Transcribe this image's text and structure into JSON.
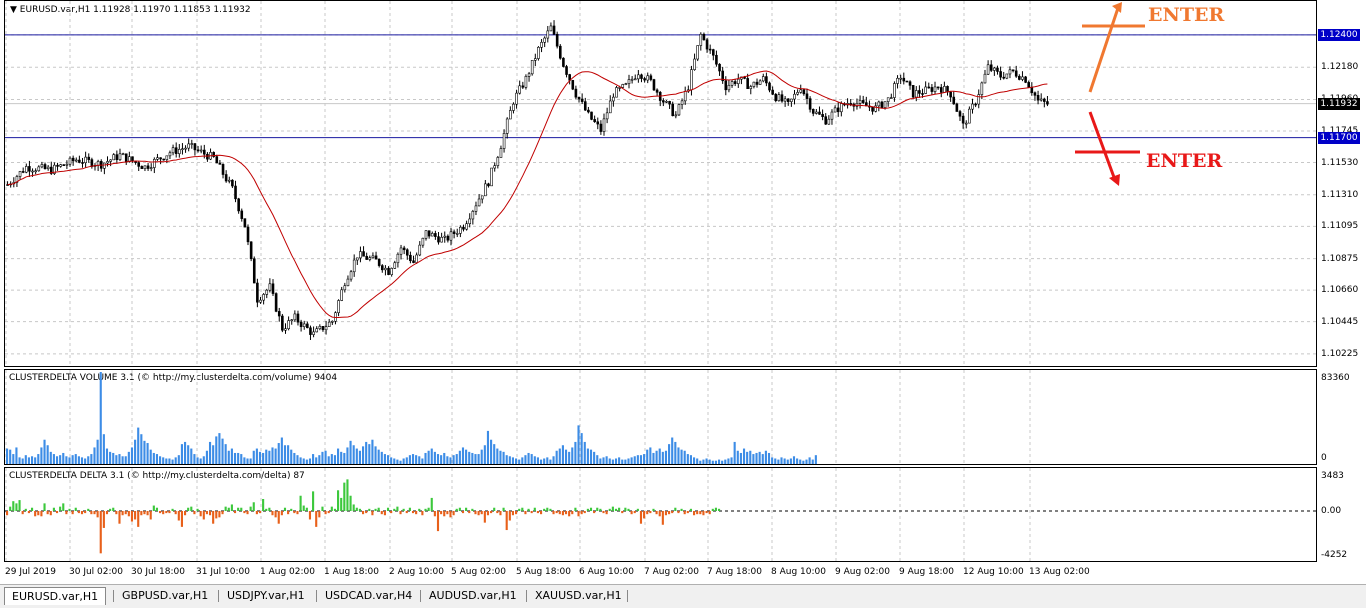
{
  "chart_window": {
    "symbol_title": "EURUSD.var,H1  1.11928 1.11970 1.11853 1.11932",
    "menu_icon": "triangle-down-icon"
  },
  "chart_data": [
    {
      "type": "candlestick",
      "title": "EURUSD.var,H1  1.11928 1.11970 1.11853 1.11932",
      "ylim": [
        1.1017,
        1.1257
      ],
      "y_ticks": [
        "1.12400",
        "1.12180",
        "1.11960",
        "1.11745",
        "1.11530",
        "1.11310",
        "1.11095",
        "1.10875",
        "1.10660",
        "1.10445",
        "1.10225"
      ],
      "x_ticks": [
        "29 Jul 2019",
        "30 Jul 02:00",
        "30 Jul 18:00",
        "31 Jul 10:00",
        "1 Aug 02:00",
        "1 Aug 18:00",
        "2 Aug 10:00",
        "5 Aug 02:00",
        "5 Aug 18:00",
        "6 Aug 10:00",
        "7 Aug 02:00",
        "7 Aug 18:00",
        "8 Aug 10:00",
        "9 Aug 02:00",
        "9 Aug 18:00",
        "12 Aug 10:00",
        "13 Aug 02:00"
      ],
      "current_price": "1.11932",
      "horizontal_levels": [
        "1.12400",
        "1.11700"
      ],
      "moving_average_color": "#c00000",
      "candle_color": "#000000",
      "grid": true,
      "close_path": [
        [
          0,
          1.1138
        ],
        [
          6,
          1.115
        ],
        [
          14,
          1.1148
        ],
        [
          22,
          1.1155
        ],
        [
          30,
          1.1152
        ],
        [
          36,
          1.1158
        ],
        [
          44,
          1.115
        ],
        [
          52,
          1.116
        ],
        [
          58,
          1.1164
        ],
        [
          66,
          1.1156
        ],
        [
          72,
          1.1135
        ],
        [
          76,
          1.111
        ],
        [
          80,
          1.106
        ],
        [
          84,
          1.1068
        ],
        [
          88,
          1.104
        ],
        [
          92,
          1.1047
        ],
        [
          98,
          1.1036
        ],
        [
          104,
          1.1045
        ],
        [
          108,
          1.1072
        ],
        [
          112,
          1.109
        ],
        [
          118,
          1.1086
        ],
        [
          122,
          1.1079
        ],
        [
          126,
          1.1095
        ],
        [
          130,
          1.1085
        ],
        [
          134,
          1.1105
        ],
        [
          140,
          1.11
        ],
        [
          146,
          1.111
        ],
        [
          150,
          1.1125
        ],
        [
          154,
          1.114
        ],
        [
          158,
          1.1165
        ],
        [
          162,
          1.1195
        ],
        [
          166,
          1.121
        ],
        [
          170,
          1.123
        ],
        [
          174,
          1.1245
        ],
        [
          178,
          1.122
        ],
        [
          182,
          1.12
        ],
        [
          186,
          1.1185
        ],
        [
          190,
          1.1175
        ],
        [
          194,
          1.12
        ],
        [
          198,
          1.1205
        ],
        [
          202,
          1.1215
        ],
        [
          206,
          1.1208
        ],
        [
          210,
          1.1195
        ],
        [
          214,
          1.1185
        ],
        [
          218,
          1.1205
        ],
        [
          222,
          1.124
        ],
        [
          226,
          1.1225
        ],
        [
          230,
          1.1205
        ],
        [
          234,
          1.121
        ],
        [
          238,
          1.1205
        ],
        [
          242,
          1.121
        ],
        [
          246,
          1.1198
        ],
        [
          250,
          1.1192
        ],
        [
          254,
          1.1205
        ],
        [
          258,
          1.1188
        ],
        [
          262,
          1.1182
        ],
        [
          266,
          1.119
        ],
        [
          270,
          1.1195
        ],
        [
          274,
          1.1192
        ],
        [
          278,
          1.119
        ],
        [
          282,
          1.1196
        ],
        [
          286,
          1.1212
        ],
        [
          290,
          1.12
        ],
        [
          294,
          1.1202
        ],
        [
          298,
          1.1205
        ],
        [
          302,
          1.12
        ],
        [
          306,
          1.1178
        ],
        [
          310,
          1.1195
        ],
        [
          314,
          1.1218
        ],
        [
          318,
          1.1212
        ],
        [
          322,
          1.1215
        ],
        [
          326,
          1.121
        ],
        [
          330,
          1.1195
        ],
        [
          333,
          1.1193
        ]
      ],
      "annotations": [
        {
          "text": "ENTER",
          "direction": "up",
          "color": "#f07830"
        },
        {
          "text": "ENTER",
          "direction": "down",
          "color": "#e81818"
        }
      ]
    },
    {
      "type": "bar",
      "title": "CLUSTERDELTA VOLUME 3.1 (© http://my.clusterdelta.com/volume) 9404",
      "ylim": [
        0,
        83360
      ],
      "y_ticks": [
        "83360",
        "0"
      ],
      "bar_color": "#3c8ce6",
      "values": [
        14000,
        13000,
        9000,
        15000,
        6000,
        5000,
        8000,
        6000,
        7000,
        6000,
        9000,
        15000,
        22000,
        17000,
        11000,
        9000,
        7000,
        8000,
        10000,
        7000,
        6000,
        8000,
        9000,
        7000,
        6000,
        5000,
        7000,
        9000,
        15000,
        22000,
        83360,
        27000,
        14000,
        11000,
        10000,
        8000,
        9000,
        7000,
        7000,
        11000,
        15000,
        22000,
        33000,
        27000,
        21000,
        19000,
        13000,
        10000,
        9000,
        7000,
        6000,
        5000,
        5000,
        4000,
        6000,
        8000,
        18000,
        20000,
        17000,
        14000,
        9000,
        6000,
        5000,
        7000,
        12000,
        20000,
        17000,
        25000,
        28000,
        23000,
        18000,
        12000,
        14000,
        10000,
        10000,
        9000,
        6000,
        5000,
        5000,
        12000,
        14000,
        11000,
        10000,
        13000,
        12000,
        15000,
        14000,
        19000,
        24000,
        17000,
        17000,
        13000,
        10000,
        8000,
        6000,
        5000,
        4000,
        5000,
        9000,
        6000,
        8000,
        11000,
        12000,
        7000,
        9000,
        8000,
        14000,
        11000,
        10000,
        15000,
        21000,
        17000,
        14000,
        12000,
        16000,
        20000,
        18000,
        22000,
        16000,
        13000,
        11000,
        9000,
        8000,
        6000,
        5000,
        4000,
        3000,
        5000,
        6000,
        8000,
        9000,
        8000,
        7000,
        5000,
        10000,
        12000,
        14000,
        11000,
        9000,
        8000,
        10000,
        7000,
        6000,
        8000,
        9000,
        12000,
        15000,
        13000,
        11000,
        10000,
        9000,
        9000,
        13000,
        17000,
        30000,
        22000,
        18000,
        14000,
        12000,
        11000,
        8000,
        7000,
        6000,
        5000,
        4000,
        6000,
        8000,
        10000,
        9000,
        7000,
        6000,
        4000,
        5000,
        6000,
        4000,
        7000,
        12000,
        14000,
        17000,
        13000,
        11000,
        15000,
        20000,
        35000,
        28000,
        20000,
        14000,
        13000,
        11000,
        8000,
        5000,
        6000,
        7000,
        5000,
        4000,
        5000,
        6000,
        4000,
        4000,
        5000,
        6000,
        7000,
        8000,
        8000,
        9000,
        13000,
        15000,
        10000,
        12000,
        14000,
        11000,
        12000,
        18000,
        24000,
        20000,
        15000,
        13000,
        12000,
        9000,
        8000,
        6000,
        5000,
        3000,
        4000,
        5000,
        4000,
        3000,
        3000,
        4000,
        3000,
        4000,
        5000,
        6000,
        20000,
        12000,
        10000,
        14000,
        11000,
        12000,
        9000,
        10000,
        11000,
        9000,
        12000,
        10000,
        6000,
        5000,
        4000,
        6000,
        5000,
        4000,
        5000,
        7000,
        5000,
        4000,
        3000,
        4000,
        6000,
        4000,
        8000
      ]
    },
    {
      "type": "bar",
      "title": "CLUSTERDELTA DELTA 3.1 (© http://my.clusterdelta.com/delta) 87",
      "ylim": [
        -4252,
        3483
      ],
      "y_ticks": [
        "3483",
        "0.00",
        "-4252"
      ],
      "positive_color": "#3cc83c",
      "negative_color": "#e8601a",
      "values": [
        -400,
        400,
        900,
        700,
        1000,
        -300,
        200,
        -200,
        300,
        -500,
        -400,
        -500,
        700,
        -300,
        -400,
        300,
        -200,
        400,
        700,
        -300,
        200,
        -300,
        300,
        -200,
        -300,
        -200,
        200,
        -300,
        -300,
        -600,
        -4000,
        -1600,
        -300,
        200,
        300,
        -300,
        -1200,
        -400,
        -300,
        -500,
        -1000,
        -800,
        -1500,
        -400,
        -300,
        -400,
        -800,
        500,
        300,
        -200,
        -300,
        -200,
        -200,
        200,
        -300,
        -900,
        -1500,
        -400,
        300,
        400,
        -300,
        200,
        -500,
        -800,
        -300,
        -400,
        -1200,
        -700,
        -600,
        -300,
        400,
        300,
        600,
        -200,
        300,
        300,
        -200,
        -300,
        400,
        800,
        -300,
        -200,
        1100,
        200,
        300,
        -400,
        -600,
        -1200,
        -400,
        300,
        -300,
        200,
        -200,
        -300,
        1400,
        500,
        300,
        -800,
        1800,
        -1500,
        -600,
        400,
        -300,
        -200,
        400,
        200,
        1900,
        1200,
        2600,
        2900,
        1400,
        600,
        300,
        200,
        -300,
        -200,
        200,
        -400,
        200,
        300,
        -300,
        -400,
        300,
        -200,
        200,
        400,
        -300,
        200,
        -200,
        300,
        -200,
        -300,
        200,
        -400,
        200,
        300,
        1200,
        -500,
        -1900,
        -300,
        -500,
        -300,
        -600,
        -400,
        200,
        300,
        -200,
        300,
        -200,
        200,
        -300,
        -400,
        -300,
        -1100,
        -400,
        -200,
        300,
        -200,
        -400,
        300,
        -1800,
        -900,
        -400,
        -300,
        200,
        300,
        -300,
        200,
        -200,
        300,
        -200,
        -300,
        200,
        300,
        200,
        -300,
        -200,
        -300,
        -400,
        -300,
        -500,
        -300,
        300,
        -500,
        -300,
        -200,
        200,
        300,
        -200,
        300,
        200,
        -200,
        -300,
        200,
        400,
        200,
        300,
        -200,
        300,
        200,
        -300,
        -200,
        200,
        -1200,
        -700,
        -300,
        -200,
        200,
        -300,
        -500,
        -1300,
        -400,
        -300,
        -200,
        300,
        -200,
        200,
        -300,
        -200,
        200,
        -400,
        -300,
        -300,
        -400,
        -200,
        -300,
        200,
        300,
        200
      ]
    }
  ],
  "tabs": [
    {
      "label": "EURUSD.var,H1",
      "active": true
    },
    {
      "label": "GBPUSD.var,H1",
      "active": false
    },
    {
      "label": "USDJPY.var,H1",
      "active": false
    },
    {
      "label": "USDCAD.var,H4",
      "active": false
    },
    {
      "label": "AUDUSD.var,H1",
      "active": false
    },
    {
      "label": "XAUUSD.var,H1",
      "active": false
    }
  ]
}
